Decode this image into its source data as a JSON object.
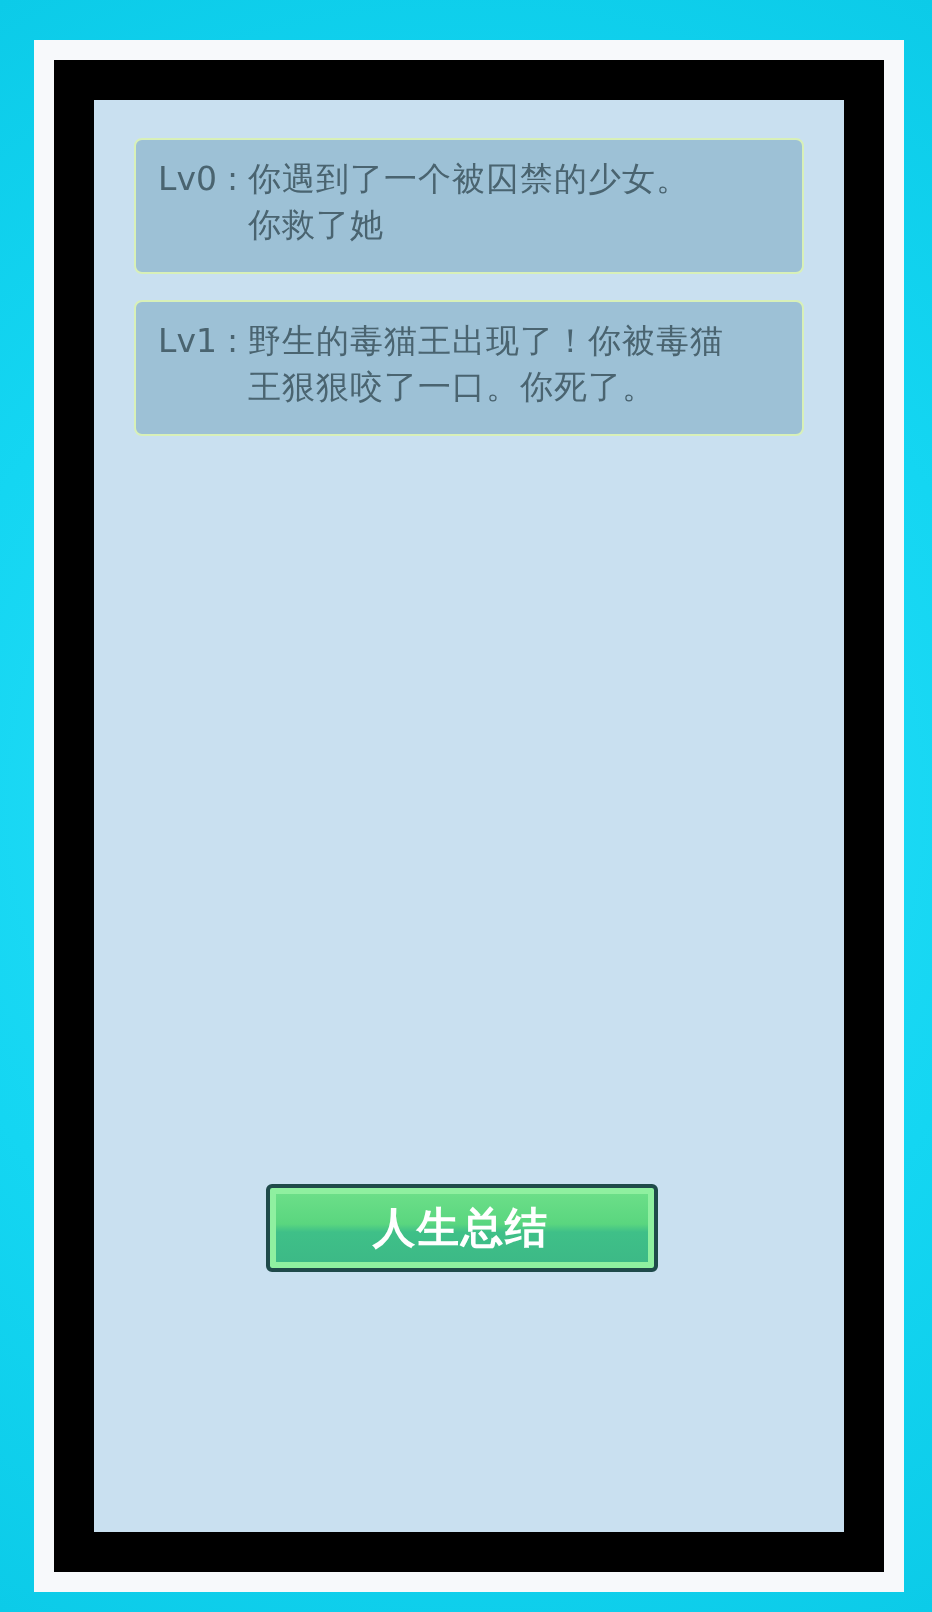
{
  "entries": [
    {
      "label": "Lv0",
      "separator": ":",
      "lines": [
        "你遇到了一个被囚禁的少女。",
        "你救了她"
      ]
    },
    {
      "label": "Lv1",
      "separator": ":",
      "lines": [
        "野生的毒猫王出现了！你被毒猫",
        "王狠狠咬了一口。你死了。"
      ]
    }
  ],
  "button": {
    "label": "人生总结"
  }
}
